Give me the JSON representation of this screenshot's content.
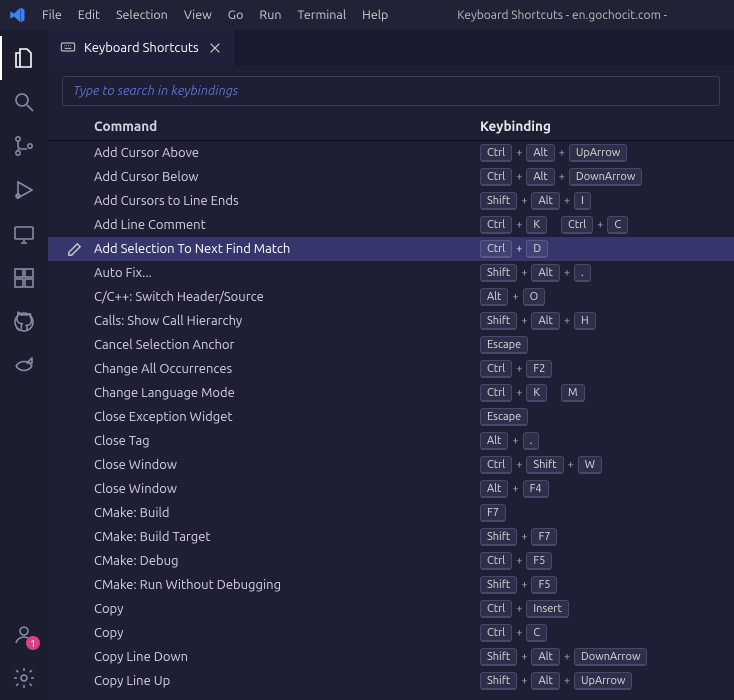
{
  "window": {
    "title": "Keyboard Shortcuts - en.gochocit.com -"
  },
  "menu": {
    "items": [
      "File",
      "Edit",
      "Selection",
      "View",
      "Go",
      "Run",
      "Terminal",
      "Help"
    ]
  },
  "activity": {
    "account_badge": "1"
  },
  "tabs": {
    "active": "Keyboard Shortcuts"
  },
  "keyboard_shortcuts": {
    "search_placeholder": "Type to search in keybindings",
    "headers": {
      "command": "Command",
      "keybinding": "Keybinding"
    },
    "selected_index": 4,
    "rows": [
      {
        "command": "Add Cursor Above",
        "keys": [
          [
            "Ctrl",
            "Alt",
            "UpArrow"
          ]
        ]
      },
      {
        "command": "Add Cursor Below",
        "keys": [
          [
            "Ctrl",
            "Alt",
            "DownArrow"
          ]
        ]
      },
      {
        "command": "Add Cursors to Line Ends",
        "keys": [
          [
            "Shift",
            "Alt",
            "I"
          ]
        ]
      },
      {
        "command": "Add Line Comment",
        "keys": [
          [
            "Ctrl",
            "K"
          ],
          [
            "Ctrl",
            "C"
          ]
        ]
      },
      {
        "command": "Add Selection To Next Find Match",
        "keys": [
          [
            "Ctrl",
            "D"
          ]
        ]
      },
      {
        "command": "Auto Fix...",
        "keys": [
          [
            "Shift",
            "Alt",
            "."
          ]
        ]
      },
      {
        "command": "C/C++: Switch Header/Source",
        "keys": [
          [
            "Alt",
            "O"
          ]
        ]
      },
      {
        "command": "Calls: Show Call Hierarchy",
        "keys": [
          [
            "Shift",
            "Alt",
            "H"
          ]
        ]
      },
      {
        "command": "Cancel Selection Anchor",
        "keys": [
          [
            "Escape"
          ]
        ]
      },
      {
        "command": "Change All Occurrences",
        "keys": [
          [
            "Ctrl",
            "F2"
          ]
        ]
      },
      {
        "command": "Change Language Mode",
        "keys": [
          [
            "Ctrl",
            "K"
          ],
          [
            "M"
          ]
        ]
      },
      {
        "command": "Close Exception Widget",
        "keys": [
          [
            "Escape"
          ]
        ]
      },
      {
        "command": "Close Tag",
        "keys": [
          [
            "Alt",
            "."
          ]
        ]
      },
      {
        "command": "Close Window",
        "keys": [
          [
            "Ctrl",
            "Shift",
            "W"
          ]
        ]
      },
      {
        "command": "Close Window",
        "keys": [
          [
            "Alt",
            "F4"
          ]
        ]
      },
      {
        "command": "CMake: Build",
        "keys": [
          [
            "F7"
          ]
        ]
      },
      {
        "command": "CMake: Build Target",
        "keys": [
          [
            "Shift",
            "F7"
          ]
        ]
      },
      {
        "command": "CMake: Debug",
        "keys": [
          [
            "Ctrl",
            "F5"
          ]
        ]
      },
      {
        "command": "CMake: Run Without Debugging",
        "keys": [
          [
            "Shift",
            "F5"
          ]
        ]
      },
      {
        "command": "Copy",
        "keys": [
          [
            "Ctrl",
            "Insert"
          ]
        ]
      },
      {
        "command": "Copy",
        "keys": [
          [
            "Ctrl",
            "C"
          ]
        ]
      },
      {
        "command": "Copy Line Down",
        "keys": [
          [
            "Shift",
            "Alt",
            "DownArrow"
          ]
        ]
      },
      {
        "command": "Copy Line Up",
        "keys": [
          [
            "Shift",
            "Alt",
            "UpArrow"
          ]
        ]
      }
    ]
  }
}
